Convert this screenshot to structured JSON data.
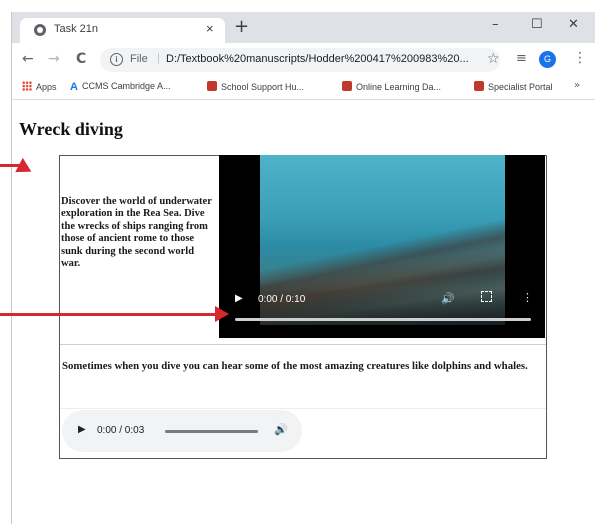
{
  "browser": {
    "tab_title": "Task 21n",
    "tab_close": "×",
    "new_tab": "+",
    "window_controls": {
      "minimize": "–",
      "maximize": "☐",
      "close": "✕"
    },
    "nav": {
      "back": "←",
      "forward": "→",
      "reload": "C"
    },
    "address": {
      "info": "i",
      "scheme": "File",
      "separator": "|",
      "url": "D:/Textbook%20manuscripts/Hodder%200417%200983%20..."
    },
    "star": "☆",
    "playlist": "≡",
    "avatar": "G",
    "menu": "⋮"
  },
  "bookmarks": [
    {
      "label": "Apps",
      "icon": "apps-grid-icon"
    },
    {
      "label": "CCMS Cambridge A...",
      "icon": "ccms-icon"
    },
    {
      "label": "School Support Hu...",
      "icon": "cambridge-shield-icon"
    },
    {
      "label": "Online Learning Da...",
      "icon": "cambridge-shield-icon"
    },
    {
      "label": "Specialist Portal",
      "icon": "cambridge-shield-icon"
    }
  ],
  "bookmarks_more": "»",
  "page": {
    "title": "Wreck diving",
    "intro": "Discover the world of underwater exploration in the Rea Sea. Dive the wrecks of ships ranging from those of ancient rome to those sunk during the second world war.",
    "video": {
      "play": "▶",
      "time": "0:00 / 0:10",
      "volume": "🔊",
      "more": "⋮",
      "progress": 0
    },
    "caption": "Sometimes when you dive you can hear some of the most amazing creatures like dolphins and whales.",
    "audio": {
      "play": "▶",
      "time": "0:00 / 0:03",
      "volume": "🔊",
      "progress": 0
    }
  },
  "colors": {
    "arrow": "#d6282e",
    "tabstrip": "#dee1e6",
    "avatar": "#1a73e8"
  }
}
